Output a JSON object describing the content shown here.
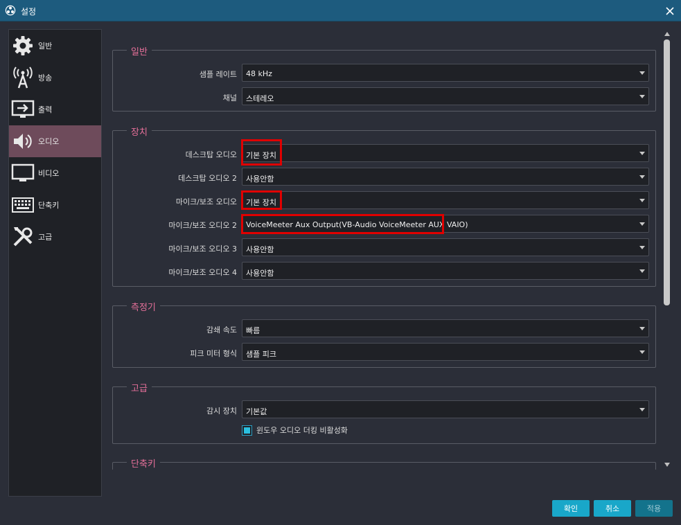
{
  "window": {
    "title": "설정"
  },
  "sidebar": {
    "items": [
      {
        "label": "일반",
        "icon": "gear-icon"
      },
      {
        "label": "방송",
        "icon": "broadcast-tower-icon"
      },
      {
        "label": "출력",
        "icon": "output-icon"
      },
      {
        "label": "오디오",
        "icon": "speaker-icon",
        "active": true
      },
      {
        "label": "비디오",
        "icon": "monitor-icon"
      },
      {
        "label": "단축키",
        "icon": "keyboard-icon"
      },
      {
        "label": "고급",
        "icon": "tools-icon"
      }
    ]
  },
  "groups": {
    "general": {
      "title": "일반",
      "sample_rate": {
        "label": "샘플 레이트",
        "value": "48 kHz"
      },
      "channels": {
        "label": "채널",
        "value": "스테레오"
      }
    },
    "devices": {
      "title": "장치",
      "desktop_audio": {
        "label": "데스크탑 오디오",
        "value": "기본 장치"
      },
      "desktop_audio_2": {
        "label": "데스크탑 오디오 2",
        "value": "사용안함"
      },
      "mic_aux": {
        "label": "마이크/보조 오디오",
        "value": "기본 장치"
      },
      "mic_aux_2": {
        "label": "마이크/보조 오디오 2",
        "value": "VoiceMeeter Aux Output(VB-Audio VoiceMeeter AUX VAIO)"
      },
      "mic_aux_3": {
        "label": "마이크/보조 오디오 3",
        "value": "사용안함"
      },
      "mic_aux_4": {
        "label": "마이크/보조 오디오 4",
        "value": "사용안함"
      }
    },
    "meters": {
      "title": "측정기",
      "decay_rate": {
        "label": "감쇄 속도",
        "value": "빠름"
      },
      "peak_meter_type": {
        "label": "피크 미터 형식",
        "value": "샘플 피크"
      }
    },
    "advanced": {
      "title": "고급",
      "monitoring_device": {
        "label": "감시 장치",
        "value": "기본값"
      },
      "disable_ducking": {
        "label": "윈도우 오디오 더킹 비활성화",
        "checked": true
      }
    },
    "hotkeys": {
      "title": "단축키"
    }
  },
  "buttons": {
    "ok": "확인",
    "cancel": "취소",
    "apply": "적용"
  },
  "colors": {
    "titlebar": "#1d5b7e",
    "background": "#2b2e38",
    "group_title": "#e6709a",
    "accent": "#19a7c9",
    "active_sidebar": "#6e4b5b",
    "highlight": "#e00000"
  }
}
